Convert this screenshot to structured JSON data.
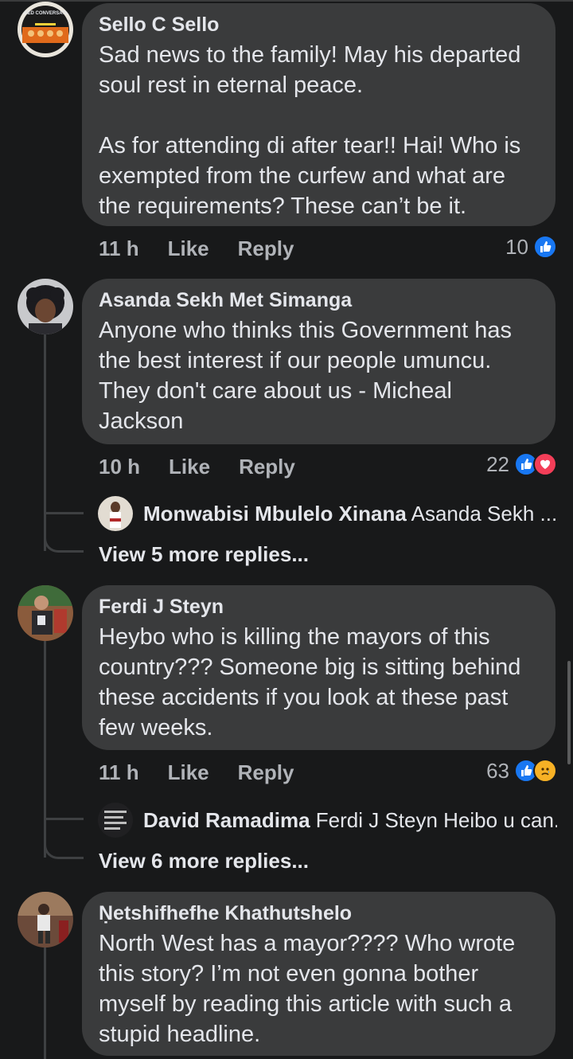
{
  "comments": [
    {
      "author": "Sello C Sello",
      "text": "Sad news to the family! May his departed soul rest in eternal peace.\n\nAs for attending di after tear!! Hai! Who is exempted from the curfew and what are the requirements? These can’t be it.",
      "time": "11 h",
      "like_label": "Like",
      "reply_label": "Reply",
      "reaction_count": "10",
      "reactions": [
        "like-icon"
      ],
      "avatar_caption": "AKED CONVERSATIO"
    },
    {
      "author": "Asanda Sekh Met Simanga",
      "text": "Anyone who thinks this Government has the best interest if our people umuncu. They don't care about us - Micheal Jackson",
      "time": "10 h",
      "like_label": "Like",
      "reply_label": "Reply",
      "reaction_count": "22",
      "reactions": [
        "like-icon",
        "love-icon"
      ],
      "reply_preview": {
        "author": "Monwabisi Mbulelo Xinana",
        "text": "Asanda Sekh ..."
      },
      "view_more": "View 5 more replies..."
    },
    {
      "author": "Ferdi J Steyn",
      "text": "Heybo who is killing the mayors of this country??? Someone big is sitting behind these accidents if you look at these past few weeks.",
      "time": "11 h",
      "like_label": "Like",
      "reply_label": "Reply",
      "reaction_count": "63",
      "reactions": [
        "like-icon",
        "sad-icon"
      ],
      "reply_preview": {
        "author": "David Ramadima",
        "text": "Ferdi J Steyn Heibo  u can..."
      },
      "view_more": "View 6 more replies..."
    },
    {
      "author": "Ṇetshifhefhe Khathutshelo",
      "text": "North West has a mayor???? Who wrote this story? I’m not even gonna bother myself by reading this article with such a stupid headline."
    }
  ],
  "colors": {
    "background": "#18191a",
    "bubble": "#3a3b3c",
    "primary_text": "#e4e6eb",
    "secondary_text": "#b0b3b8",
    "like_blue": "#1877f2",
    "love_red": "#f33e58",
    "sad_yellow": "#f7b125"
  }
}
